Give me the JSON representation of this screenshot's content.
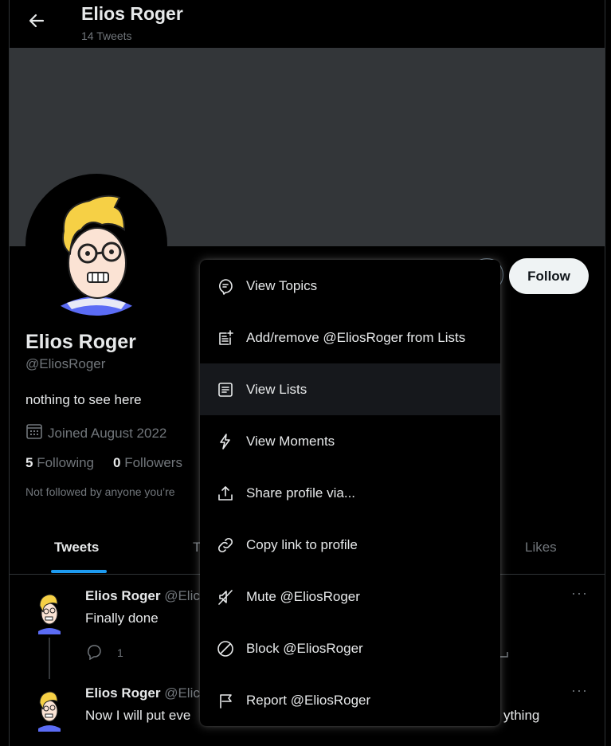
{
  "header": {
    "name": "Elios Roger",
    "tweet_count": "14 Tweets"
  },
  "profile": {
    "name": "Elios Roger",
    "handle": "@EliosRoger",
    "bio": "nothing to see here",
    "joined": "Joined August 2022",
    "following_count": "5",
    "following_label": "Following",
    "followers_count": "0",
    "followers_label": "Followers",
    "not_followed": "Not followed by anyone you’re"
  },
  "follow_button": "Follow",
  "tabs": [
    "Tweets",
    "T",
    "Likes"
  ],
  "tweets": [
    {
      "name": "Elios Roger",
      "handle": "@Elic",
      "text": "Finally done",
      "replies": "1"
    },
    {
      "name": "Elios Roger",
      "handle": "@Elic",
      "text": "Now I will put eve",
      "text_tail": "ything"
    }
  ],
  "menu": {
    "items": [
      {
        "label": "View Topics",
        "icon": "topics-icon"
      },
      {
        "label": "Add/remove @EliosRoger from Lists",
        "icon": "list-add-icon"
      },
      {
        "label": "View Lists",
        "icon": "lists-icon"
      },
      {
        "label": "View Moments",
        "icon": "lightning-icon"
      },
      {
        "label": "Share profile via...",
        "icon": "share-icon"
      },
      {
        "label": "Copy link to profile",
        "icon": "link-icon"
      },
      {
        "label": "Mute @EliosRoger",
        "icon": "mute-icon"
      },
      {
        "label": "Block @EliosRoger",
        "icon": "block-icon"
      },
      {
        "label": "Report @EliosRoger",
        "icon": "flag-icon"
      }
    ],
    "hovered_index": 2
  },
  "colors": {
    "accent": "#1d9bf0",
    "banner": "#333639",
    "follow_bg": "#eff3f4"
  }
}
